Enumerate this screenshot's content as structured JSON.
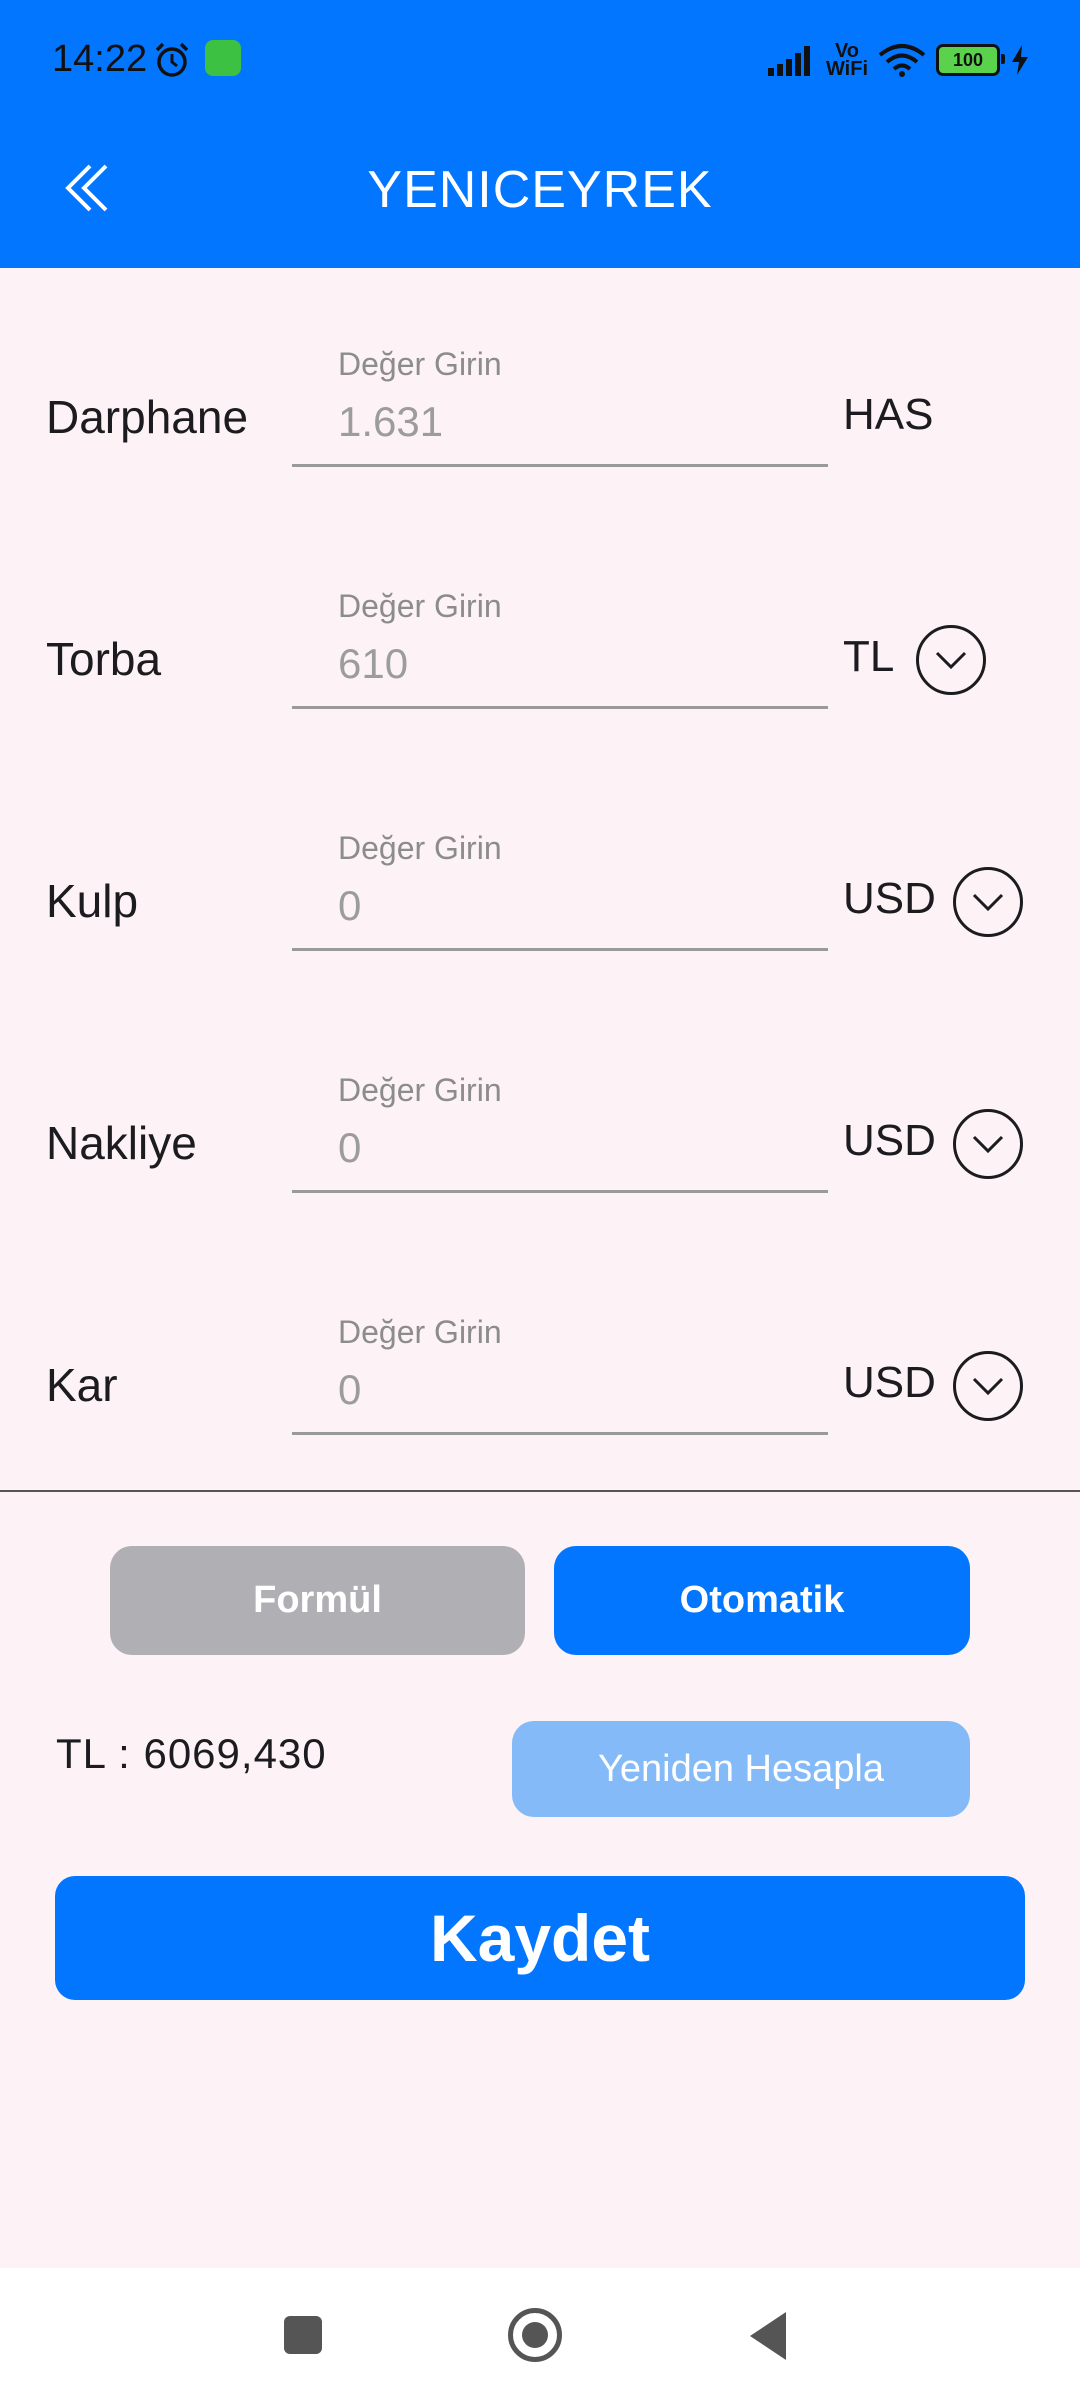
{
  "status_bar": {
    "time": "14:22",
    "alarm_icon": "alarm-icon",
    "app_icon": "app-badge-icon",
    "network_label_top": "Vo",
    "network_label_bottom": "WiFi",
    "battery": "100"
  },
  "app_bar": {
    "title": "YENICEYREK",
    "back_icon": "double-chevron-left-icon"
  },
  "form": {
    "rows": [
      {
        "label": "Darphane",
        "caption": "Değer Girin",
        "value": "1.631",
        "unit": "HAS",
        "has_dropdown": false
      },
      {
        "label": "Torba",
        "caption": "Değer Girin",
        "value": "610",
        "unit": "TL",
        "has_dropdown": true
      },
      {
        "label": "Kulp",
        "caption": "Değer Girin",
        "value": "0",
        "unit": "USD",
        "has_dropdown": true
      },
      {
        "label": "Nakliye",
        "caption": "Değer Girin",
        "value": "0",
        "unit": "USD",
        "has_dropdown": true
      },
      {
        "label": "Kar",
        "caption": "Değer Girin",
        "value": "0",
        "unit": "USD",
        "has_dropdown": true
      }
    ]
  },
  "mode_buttons": {
    "formul": "Formül",
    "otomatik": "Otomatik",
    "active": "otomatik"
  },
  "result": {
    "total": "TL : 6069,430",
    "recalc_label": "Yeniden Hesapla"
  },
  "save_label": "Kaydet",
  "colors": {
    "primary": "#0276fe",
    "background": "#fdf3f6",
    "inactive_button": "#b0afb3",
    "disabled_button": "#84baf8"
  }
}
